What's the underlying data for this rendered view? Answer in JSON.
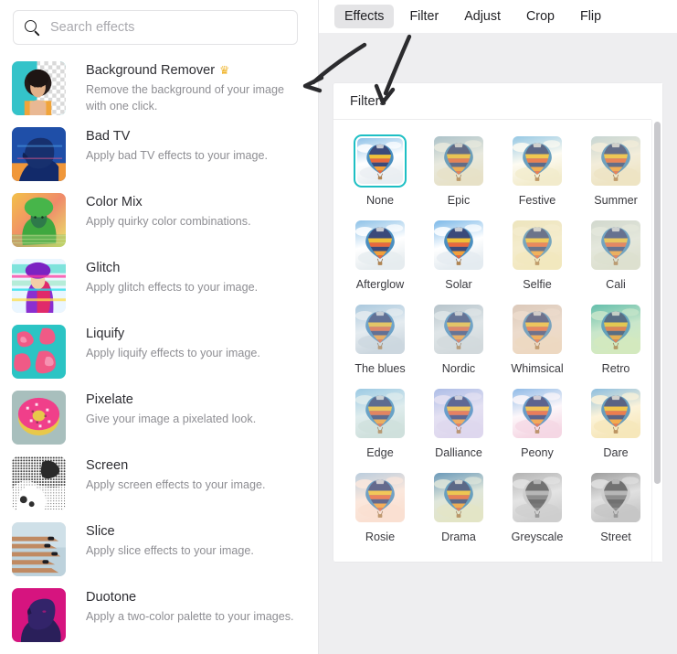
{
  "search": {
    "placeholder": "Search effects",
    "value": "",
    "icon": "search-icon"
  },
  "sidebar": {
    "effects": [
      {
        "title": "Background Remover",
        "desc": "Remove the background of your image with one click.",
        "premium": true,
        "crown": "♛"
      },
      {
        "title": "Bad TV",
        "desc": "Apply bad TV effects to your image.",
        "premium": false,
        "crown": ""
      },
      {
        "title": "Color Mix",
        "desc": "Apply quirky color combinations.",
        "premium": false,
        "crown": ""
      },
      {
        "title": "Glitch",
        "desc": "Apply glitch effects to your image.",
        "premium": false,
        "crown": ""
      },
      {
        "title": "Liquify",
        "desc": "Apply liquify effects to your image.",
        "premium": false,
        "crown": ""
      },
      {
        "title": "Pixelate",
        "desc": "Give your image a pixelated look.",
        "premium": false,
        "crown": ""
      },
      {
        "title": "Screen",
        "desc": "Apply screen effects to your image.",
        "premium": false,
        "crown": ""
      },
      {
        "title": "Slice",
        "desc": "Apply slice effects to your image.",
        "premium": false,
        "crown": ""
      },
      {
        "title": "Duotone",
        "desc": "Apply a two-color palette to your images.",
        "premium": false,
        "crown": ""
      }
    ]
  },
  "tabs": [
    {
      "label": "Effects",
      "active": true
    },
    {
      "label": "Filter",
      "active": false
    },
    {
      "label": "Adjust",
      "active": false
    },
    {
      "label": "Crop",
      "active": false
    },
    {
      "label": "Flip",
      "active": false
    }
  ],
  "filters_panel": {
    "title": "Filters",
    "selected": "None",
    "selection_color": "#1dbfc4",
    "items": [
      {
        "label": "None",
        "sky": "#8fc2e8",
        "cloud": "#ffffff",
        "ground": "#e9eef2",
        "sat": 1.0,
        "tint": "none"
      },
      {
        "label": "Epic",
        "sky": "#9dbdd4",
        "cloud": "#eef2f0",
        "ground": "#ece7d2",
        "sat": 0.85,
        "tint": "#d9cfa8"
      },
      {
        "label": "Festive",
        "sky": "#7fc0ee",
        "cloud": "#ffffff",
        "ground": "#f2ecd0",
        "sat": 1.15,
        "tint": "#f7e9b8"
      },
      {
        "label": "Summer",
        "sky": "#bcd3dd",
        "cloud": "#f6f2e6",
        "ground": "#efe6c8",
        "sat": 0.9,
        "tint": "#eadfb4"
      },
      {
        "label": "Afterglow",
        "sky": "#8dc1e7",
        "cloud": "#ffffff",
        "ground": "#e6ecef",
        "sat": 1.0,
        "tint": "none"
      },
      {
        "label": "Solar",
        "sky": "#7bb8e8",
        "cloud": "#ffffff",
        "ground": "#e4ebf0",
        "sat": 1.2,
        "tint": "none"
      },
      {
        "label": "Selfie",
        "sky": "#ece4c0",
        "cloud": "#f6efd6",
        "ground": "#f3e9c2",
        "sat": 0.75,
        "tint": "#f0e4b4"
      },
      {
        "label": "Cali",
        "sky": "#cfd7cf",
        "cloud": "#e9ece3",
        "ground": "#dfe2d2",
        "sat": 0.7,
        "tint": "#d8dcc8"
      },
      {
        "label": "The blues",
        "sky": "#9fc4de",
        "cloud": "#f2f6f8",
        "ground": "#cfd9e0",
        "sat": 0.65,
        "tint": "#c3d2de"
      },
      {
        "label": "Nordic",
        "sky": "#aebdc6",
        "cloud": "#e9eef0",
        "ground": "#d7dde0",
        "sat": 0.55,
        "tint": "#c9d2d6"
      },
      {
        "label": "Whimsical",
        "sky": "#d6c6bc",
        "cloud": "#eee0d6",
        "ground": "#f0dcc6",
        "sat": 0.6,
        "tint": "#e9cfb6"
      },
      {
        "label": "Retro",
        "sky": "#49b3ac",
        "cloud": "#cfe8d6",
        "ground": "#dcecc6",
        "sat": 0.9,
        "tint": "#b9e0a8"
      },
      {
        "label": "Edge",
        "sky": "#8cc3e6",
        "cloud": "#e4f0f2",
        "ground": "#cfe0dc",
        "sat": 0.95,
        "tint": "#cfe2dd"
      },
      {
        "label": "Dalliance",
        "sky": "#9fb6e4",
        "cloud": "#e6e4f2",
        "ground": "#ded8ee",
        "sat": 1.0,
        "tint": "#ddd6f0"
      },
      {
        "label": "Peony",
        "sky": "#79b5e8",
        "cloud": "#ffffff",
        "ground": "#f6d8e4",
        "sat": 1.15,
        "tint": "#f7d4e2"
      },
      {
        "label": "Dare",
        "sky": "#77b6e8",
        "cloud": "#fdf6e2",
        "ground": "#f6e7bc",
        "sat": 1.25,
        "tint": "#f8e6b0"
      },
      {
        "label": "Rosie",
        "sky": "#a9c8e0",
        "cloud": "#fbeae0",
        "ground": "#fae0d2",
        "sat": 1.0,
        "tint": "#fbdfd0"
      },
      {
        "label": "Drama",
        "sky": "#4e88b8",
        "cloud": "#dfe8e2",
        "ground": "#e4e6c8",
        "sat": 1.1,
        "tint": "#dfe3bc"
      },
      {
        "label": "Greyscale",
        "sky": "#b8b8b8",
        "cloud": "#f0f0f0",
        "ground": "#d8d8d8",
        "sat": 0.0,
        "tint": "none"
      },
      {
        "label": "Street",
        "sky": "#a0a0a0",
        "cloud": "#ededed",
        "ground": "#cecece",
        "sat": 0.0,
        "tint": "none"
      }
    ]
  },
  "annotations": [
    {
      "name": "arrow-to-effects-list",
      "color": "#2b2b2e"
    },
    {
      "name": "arrow-to-filters-panel",
      "color": "#2b2b2e"
    }
  ]
}
